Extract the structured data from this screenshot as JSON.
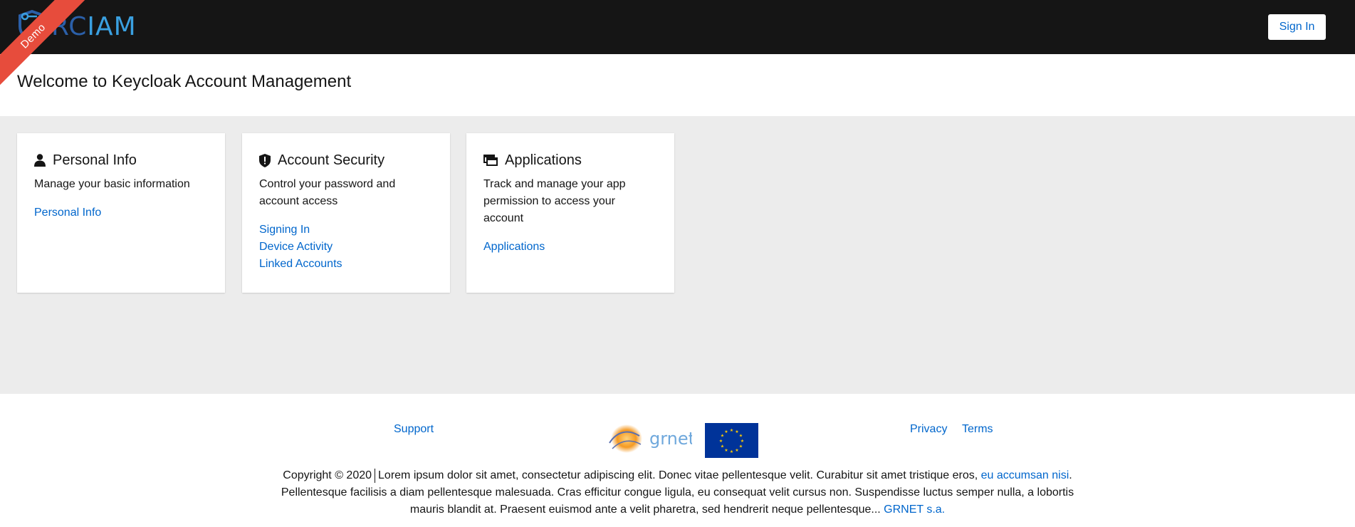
{
  "header": {
    "logo_rc": "RC",
    "logo_iam": "IAM",
    "ribbon": "Demo",
    "signin_label": "Sign In"
  },
  "welcome": {
    "title": "Welcome to Keycloak Account Management"
  },
  "cards": [
    {
      "title": "Personal Info",
      "icon": "user-icon",
      "description": "Manage your basic information",
      "links": [
        "Personal Info"
      ]
    },
    {
      "title": "Account Security",
      "icon": "shield-icon",
      "description": "Control your password and account access",
      "links": [
        "Signing In",
        "Device Activity",
        "Linked Accounts"
      ]
    },
    {
      "title": "Applications",
      "icon": "applications-icon",
      "description": "Track and manage your app permission to access your account",
      "links": [
        "Applications"
      ]
    }
  ],
  "footer": {
    "support": "Support",
    "privacy": "Privacy",
    "terms": "Terms",
    "grnet_logo": "grnet",
    "copyright_prefix": "Copyright © 2020",
    "body_1": "Lorem ipsum dolor sit amet, consectetur adipiscing elit. Donec vitae pellentesque velit. Curabitur sit amet tristique eros,",
    "link_1": "eu accumsan nisi",
    "body_2": ". Pellentesque facilisis a diam pellentesque malesuada. Cras efficitur congue ligula, eu consequat velit cursus non. Suspendisse luctus semper nulla, a lobortis mauris blandit at. Praesent euismod ante a velit pharetra, sed hendrerit neque pellentesque...",
    "link_2": "GRNET s.a."
  },
  "colors": {
    "header_bg": "#151515",
    "link": "#0066cc",
    "ribbon": "#e74c3c",
    "main_bg": "#ececec"
  }
}
